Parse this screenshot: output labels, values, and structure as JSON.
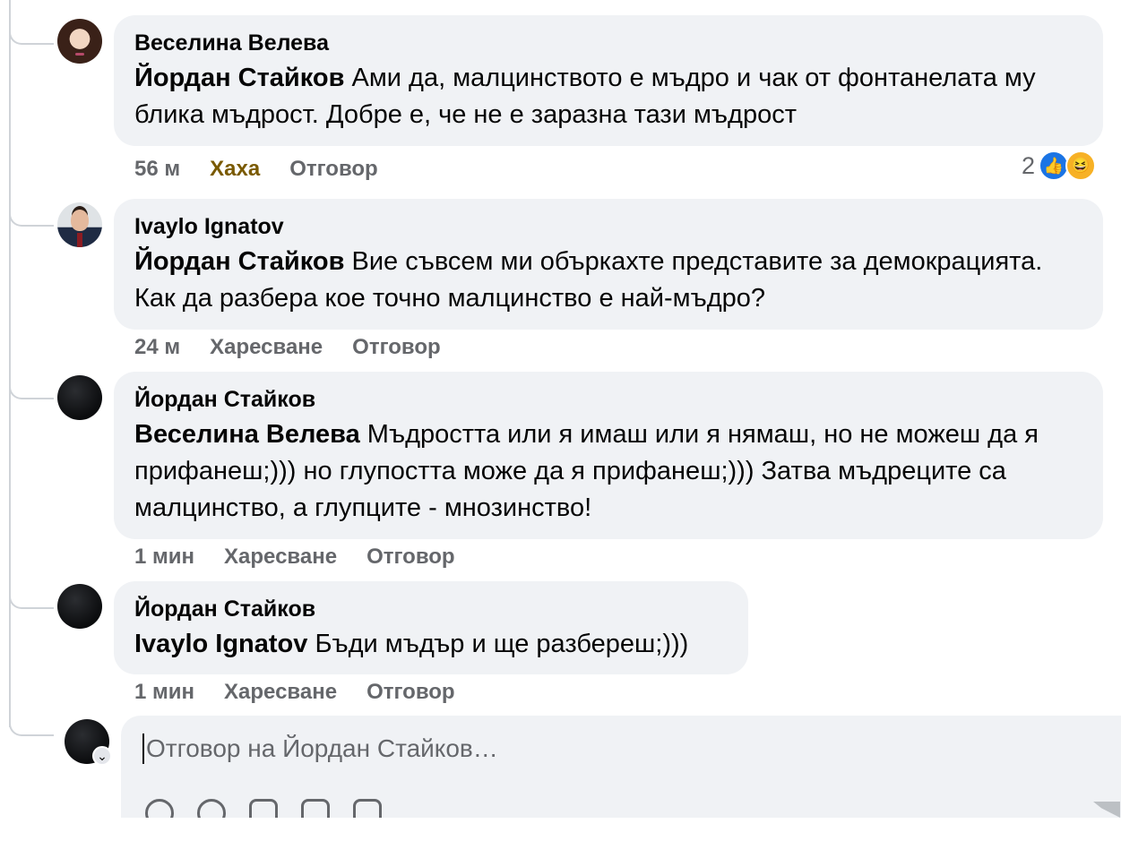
{
  "comments": [
    {
      "author": "Веселина Велева",
      "mention": "Йордан Стайков",
      "text": "Ами да, малцинството е мъдро и чак от фонтанелата му блика мъдрост. Добре е, че не е заразна тази мъдрост",
      "time": "56 м",
      "like_label": "Хаха",
      "reply_label": "Отговор",
      "reaction_count": "2",
      "avatar_icon": "woman-avatar"
    },
    {
      "author": "Ivaylo Ignatov",
      "mention": "Йордан Стайков",
      "text": "Вие съвсем ми объркахте представите за демокрацията. Как да разбера кое точно малцинство е най-мъдро?",
      "time": "24 м",
      "like_label": "Харесване",
      "reply_label": "Отговор",
      "avatar_icon": "man-avatar"
    },
    {
      "author": "Йордан Стайков",
      "mention": "Веселина Велева",
      "text": "Мъдростта или я имаш или я нямаш, но не можеш да я прифанеш;))) но глупостта може да я прифанеш;))) Затва мъдреците са малцинство, а глупците - мнозинство!",
      "time": "1 мин",
      "like_label": "Харесване",
      "reply_label": "Отговор",
      "avatar_icon": "dark-avatar"
    },
    {
      "author": "Йордан Стайков",
      "mention": "Ivaylo Ignatov",
      "text": "Бъди мъдър и ще разбереш;)))",
      "time": "1 мин",
      "like_label": "Харесване",
      "reply_label": "Отговор",
      "avatar_icon": "dark-avatar"
    }
  ],
  "reply_box": {
    "placeholder": "Отговор на Йордан Стайков…"
  },
  "colors": {
    "bubble": "#f0f2f5",
    "meta_text": "#65676b",
    "haha_active": "#7a5a00",
    "like_blue": "#1b74e4",
    "haha_yellow": "#f7b125"
  }
}
